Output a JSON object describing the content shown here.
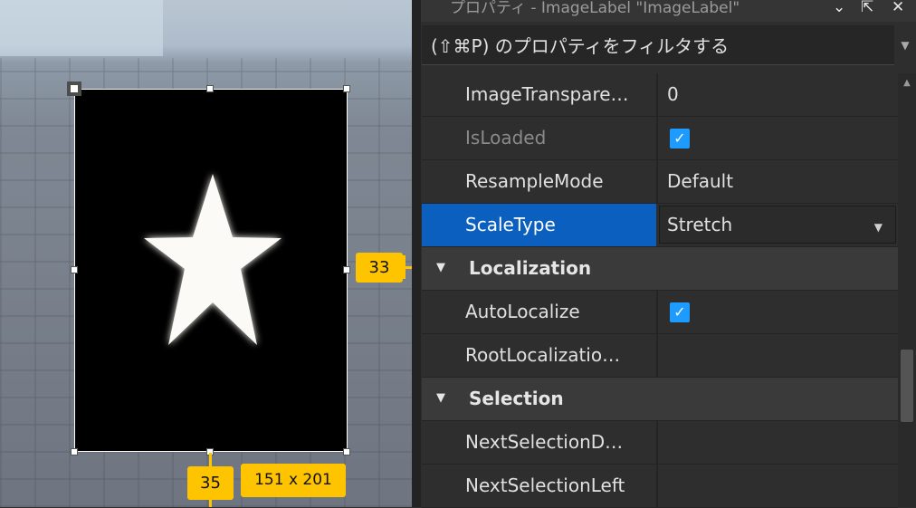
{
  "panel": {
    "title": "プロパティ - ImageLabel \"ImageLabel\"",
    "filter_placeholder": "(⇧⌘P) のプロパティをフィルタする"
  },
  "rows": {
    "image_transparency": {
      "name": "ImageTranspare…",
      "value": "0"
    },
    "is_loaded": {
      "name": "IsLoaded",
      "checked": true
    },
    "resample_mode": {
      "name": "ResampleMode",
      "value": "Default"
    },
    "scale_type": {
      "name": "ScaleType",
      "value": "Stretch"
    },
    "localization_header": "Localization",
    "auto_localize": {
      "name": "AutoLocalize",
      "checked": true
    },
    "root_localization": {
      "name": "RootLocalizatio…",
      "value": ""
    },
    "selection_header": "Selection",
    "next_selection_down": {
      "name": "NextSelectionD…",
      "value": ""
    },
    "next_selection_left": {
      "name": "NextSelectionLeft",
      "value": ""
    }
  },
  "viewport": {
    "badge_right": "33",
    "badge_bottom": "35",
    "badge_size": "151 x 201"
  },
  "colors": {
    "selected_row": "#0b5fbf",
    "badge": "#ffc400",
    "checkbox": "#1e9bff",
    "panel_bg": "#2e2e2e"
  },
  "icons": {
    "title_right": [
      "chevron-down-icon",
      "expand-icon",
      "close-icon"
    ],
    "checkbox": "checkmark-icon",
    "image": "star-icon"
  }
}
